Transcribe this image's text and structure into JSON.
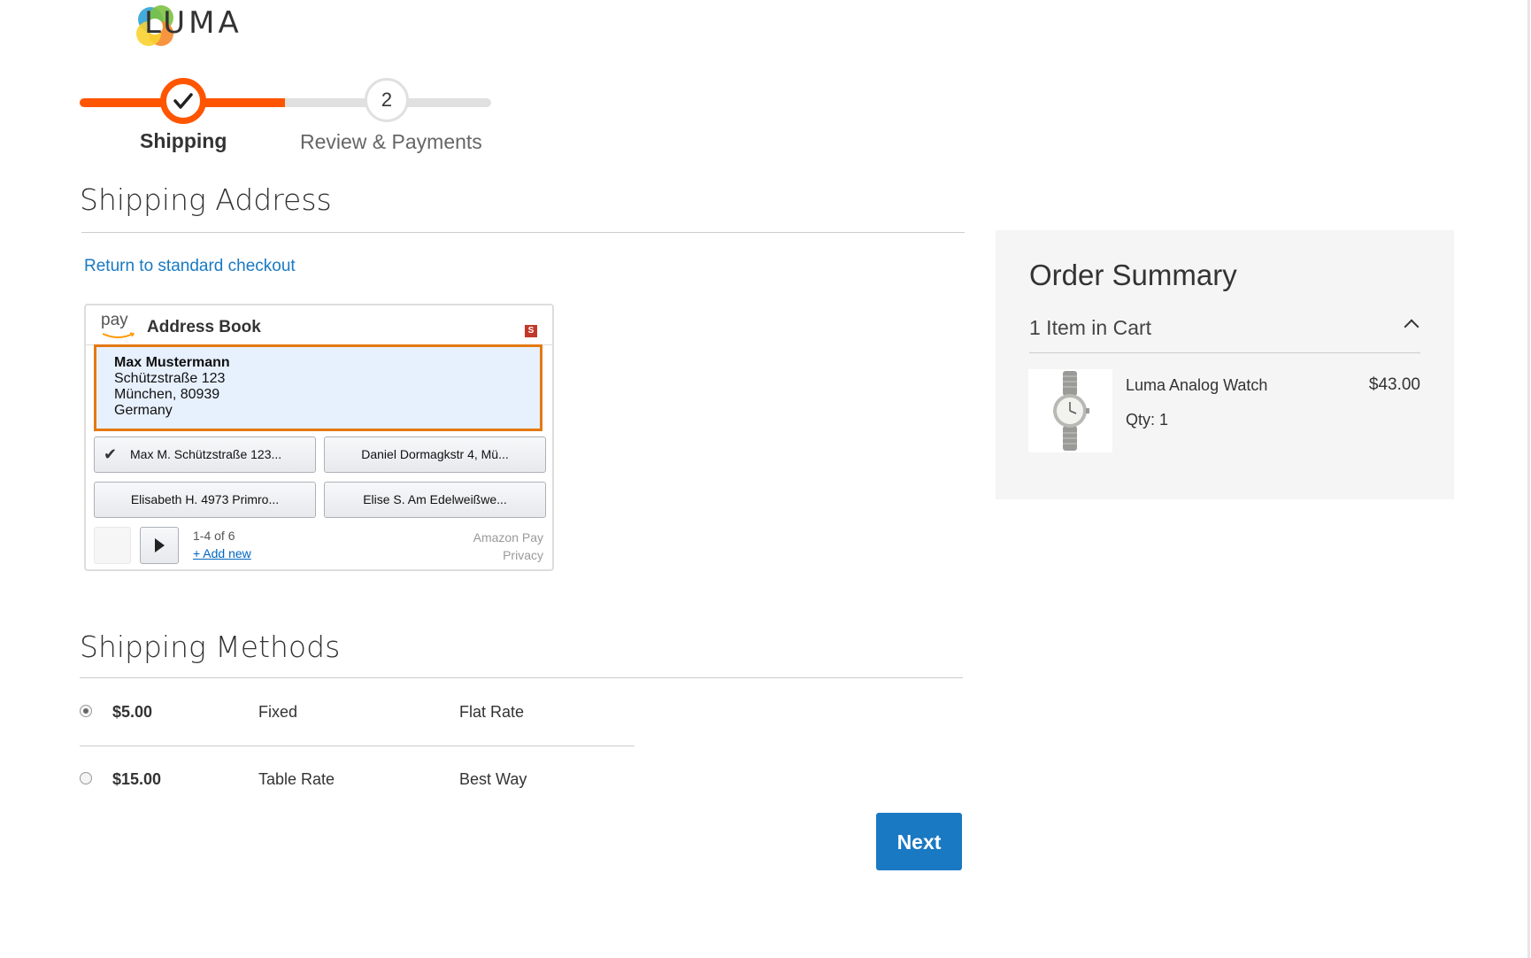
{
  "brand": {
    "name": "LUMA"
  },
  "progress": {
    "steps": [
      {
        "label": "Shipping",
        "state": "complete"
      },
      {
        "label": "Review & Payments",
        "number": "2",
        "state": "pending"
      }
    ]
  },
  "shipping_address": {
    "title": "Shipping Address",
    "return_link": "Return to standard checkout",
    "address_book": {
      "pay_label": "pay",
      "title": "Address Book",
      "badge": "S",
      "selected": {
        "name": "Max Mustermann",
        "street": "Schützstraße 123",
        "city": "München, 80939",
        "country": "Germany"
      },
      "options": [
        {
          "label": "Max M. Schützstraße 123...",
          "check": "✔"
        },
        {
          "label": "Daniel Dormagkstr 4, Mü..."
        },
        {
          "label": "Elisabeth H. 4973 Primro..."
        },
        {
          "label": "Elise S. Am Edelweißwe..."
        }
      ],
      "pager": {
        "count": "1-4 of 6",
        "add_new": "+ Add new"
      },
      "footer": {
        "brand": "Amazon Pay",
        "privacy": "Privacy"
      }
    }
  },
  "shipping_methods": {
    "title": "Shipping Methods",
    "rows": [
      {
        "price": "$5.00",
        "method": "Fixed",
        "carrier": "Flat Rate",
        "selected": true
      },
      {
        "price": "$15.00",
        "method": "Table Rate",
        "carrier": "Best Way",
        "selected": false
      }
    ],
    "next_label": "Next"
  },
  "order_summary": {
    "title": "Order Summary",
    "items_count": "1 Item in Cart",
    "items": [
      {
        "name": "Luma Analog Watch",
        "price": "$43.00",
        "qty": "Qty: 1"
      }
    ]
  },
  "colors": {
    "accent": "#ff5501",
    "primary_button": "#1979c3",
    "link": "#1979c3",
    "summary_bg": "#f5f5f5",
    "selected_border": "#e47911"
  }
}
